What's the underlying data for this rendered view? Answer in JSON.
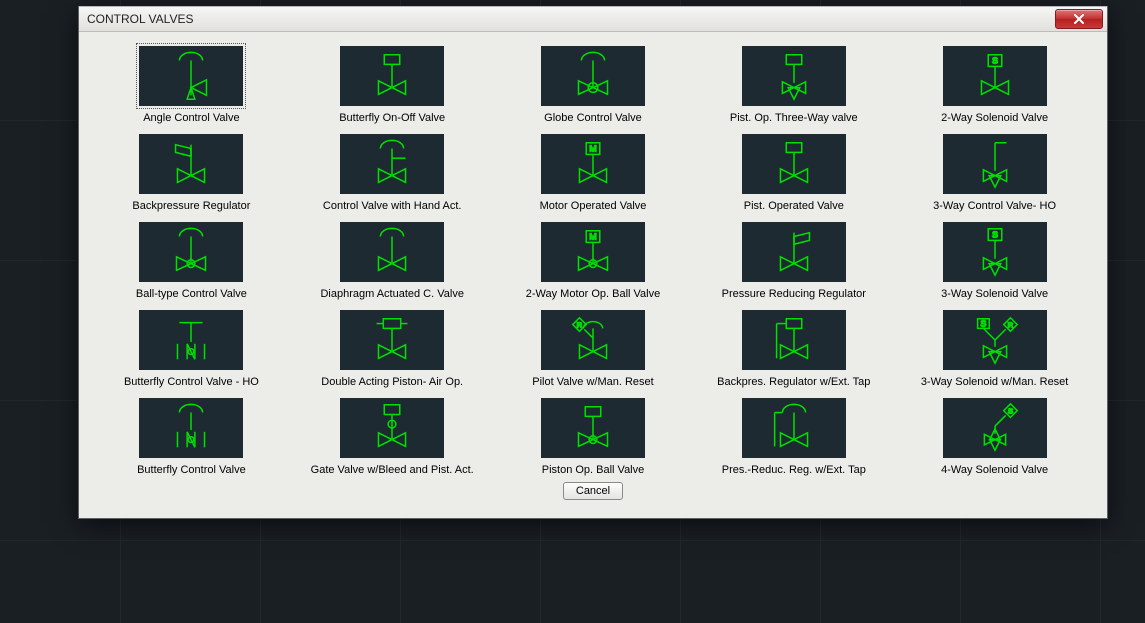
{
  "window": {
    "title": "CONTROL VALVES",
    "cancel_label": "Cancel"
  },
  "items": [
    {
      "label": "Angle Control Valve",
      "icon": "angle-control-valve",
      "selected": true
    },
    {
      "label": "Butterfly On-Off Valve",
      "icon": "butterfly-on-off-valve",
      "selected": false
    },
    {
      "label": "Globe Control Valve",
      "icon": "globe-control-valve",
      "selected": false
    },
    {
      "label": "Pist. Op. Three-Way valve",
      "icon": "pist-op-three-way-valve",
      "selected": false
    },
    {
      "label": "2-Way Solenoid Valve",
      "icon": "two-way-solenoid-valve",
      "selected": false
    },
    {
      "label": "Backpressure Regulator",
      "icon": "backpressure-regulator",
      "selected": false
    },
    {
      "label": "Control Valve with Hand Act.",
      "icon": "control-valve-hand-act",
      "selected": false
    },
    {
      "label": "Motor Operated Valve",
      "icon": "motor-operated-valve",
      "selected": false
    },
    {
      "label": "Pist. Operated Valve",
      "icon": "pist-operated-valve",
      "selected": false
    },
    {
      "label": "3-Way Control Valve- HO",
      "icon": "three-way-control-valve-ho",
      "selected": false
    },
    {
      "label": "Ball-type Control Valve",
      "icon": "ball-type-control-valve",
      "selected": false
    },
    {
      "label": "Diaphragm Actuated C. Valve",
      "icon": "diaphragm-actuated-c-valve",
      "selected": false
    },
    {
      "label": "2-Way Motor Op. Ball Valve",
      "icon": "two-way-motor-op-ball-valve",
      "selected": false
    },
    {
      "label": "Pressure Reducing Regulator",
      "icon": "pressure-reducing-regulator",
      "selected": false
    },
    {
      "label": "3-Way Solenoid Valve",
      "icon": "three-way-solenoid-valve",
      "selected": false
    },
    {
      "label": "Butterfly Control Valve - HO",
      "icon": "butterfly-control-valve-ho",
      "selected": false
    },
    {
      "label": "Double Acting Piston- Air Op.",
      "icon": "double-acting-piston-air-op",
      "selected": false
    },
    {
      "label": "Pilot Valve w/Man. Reset",
      "icon": "pilot-valve-man-reset",
      "selected": false
    },
    {
      "label": "Backpres. Regulator w/Ext. Tap",
      "icon": "backpres-regulator-ext-tap",
      "selected": false
    },
    {
      "label": "3-Way Solenoid w/Man. Reset",
      "icon": "three-way-solenoid-man-reset",
      "selected": false
    },
    {
      "label": "Butterfly Control Valve",
      "icon": "butterfly-control-valve",
      "selected": false
    },
    {
      "label": "Gate Valve w/Bleed and Pist. Act.",
      "icon": "gate-valve-bleed-pist-act",
      "selected": false
    },
    {
      "label": "Piston Op. Ball Valve",
      "icon": "piston-op-ball-valve",
      "selected": false
    },
    {
      "label": "Pres.-Reduc. Reg. w/Ext. Tap",
      "icon": "pres-reduc-reg-ext-tap",
      "selected": false
    },
    {
      "label": "4-Way Solenoid Valve",
      "icon": "four-way-solenoid-valve",
      "selected": false
    }
  ]
}
